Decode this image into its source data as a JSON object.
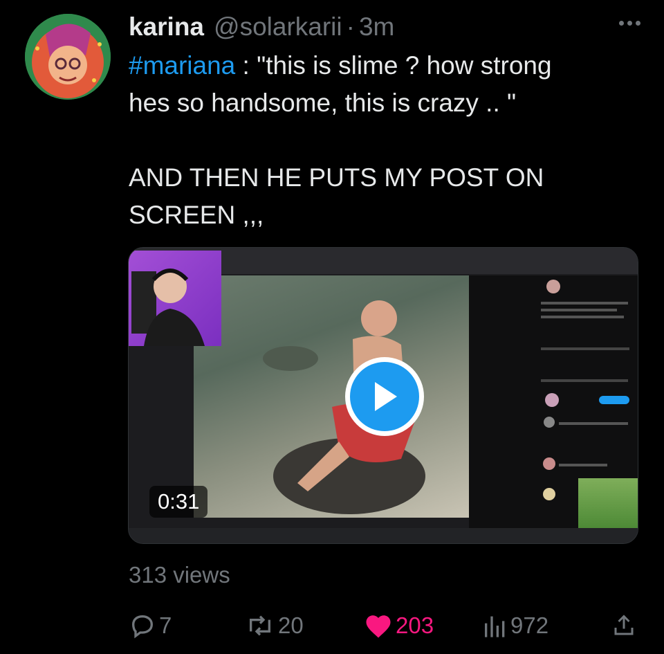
{
  "tweet": {
    "author_name": "karina",
    "handle": "@solarkarii",
    "separator": "·",
    "time": "3m",
    "hashtag": "#mariana",
    "line1_rest": " : \"this is slime ? how strong",
    "line2": "hes so handsome, this is crazy .. \"",
    "line3": "AND THEN HE PUTS MY POST ON",
    "line4": "SCREEN ,,,"
  },
  "media": {
    "duration": "0:31"
  },
  "stats": {
    "views": "313 views",
    "replies": "7",
    "reposts": "20",
    "likes": "203",
    "analytics": "972"
  },
  "colors": {
    "accent": "#1d9bf0",
    "like": "#f91880",
    "muted": "#71767b",
    "text": "#e7e9ea",
    "background": "#000000"
  },
  "icons": [
    "avatar",
    "more-icon",
    "play-icon",
    "reply-icon",
    "repost-icon",
    "heart-icon",
    "analytics-icon",
    "share-icon"
  ]
}
